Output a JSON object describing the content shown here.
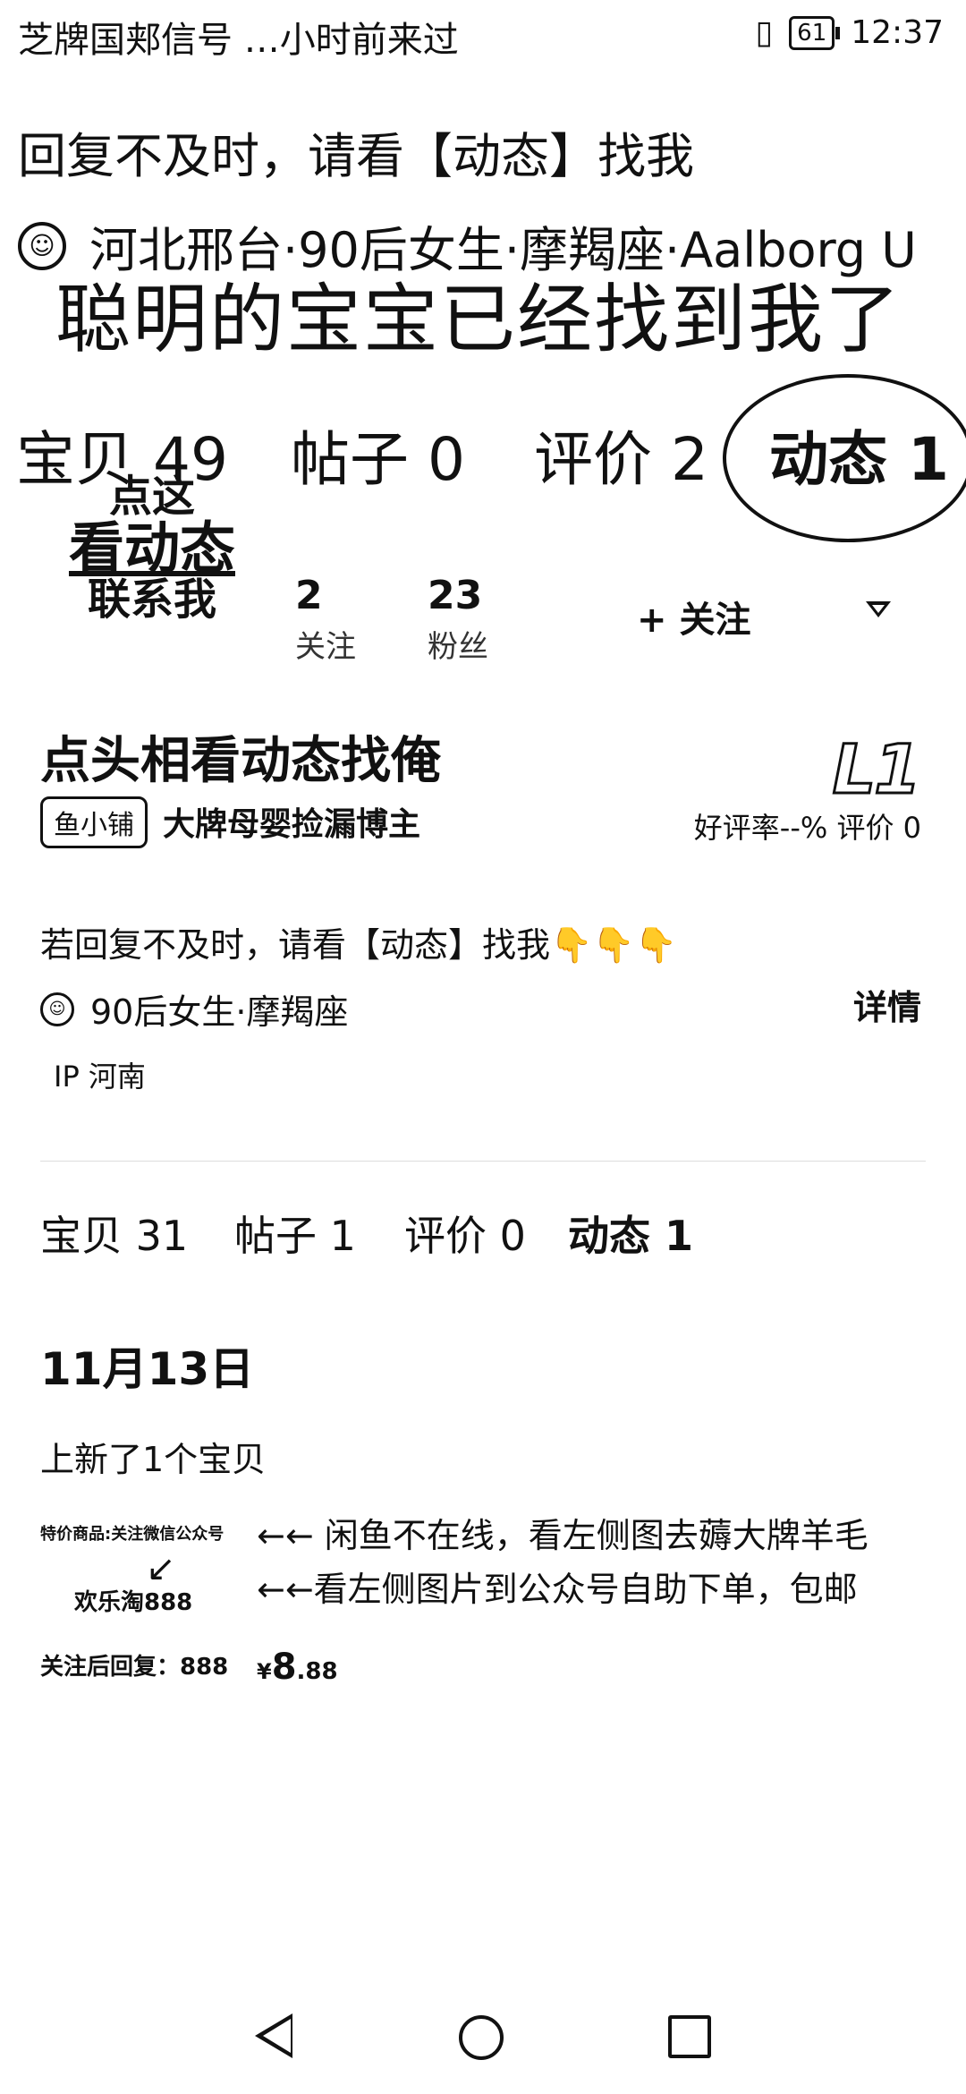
{
  "status_bar": {
    "left_text": "芝牌国郏信号 …小时前来过",
    "battery": "61",
    "time": "12:37"
  },
  "banner": {
    "line1": "回复不及时，请看【动态】找我",
    "line2": "河北邢台·90后女生·摩羯座·Aalborg U",
    "line3": "聪明的宝宝已经找到我了",
    "tabs": [
      "宝贝 49",
      "帖子 0",
      "评价 2",
      "动态 1"
    ]
  },
  "profile": {
    "shout": [
      "点这",
      "看动态",
      "联系我"
    ],
    "stats": [
      {
        "num": "2",
        "label": "关注"
      },
      {
        "num": "23",
        "label": "粉丝"
      }
    ],
    "follow_label": "+ 关注",
    "shop_name": "点头相看动态找俺",
    "level": "L1",
    "shop_badge": "鱼小铺",
    "shop_tag": "大牌母婴捡漏博主",
    "rating": "好评率--%  评价 0",
    "bio": "若回复不及时，请看【动态】找我👇👇👇",
    "identity": "90后女生·摩羯座",
    "detail_label": "详情",
    "ip": "IP 河南"
  },
  "profile_tabs": [
    "宝贝 31",
    "帖子 1",
    "评价 0",
    "动态 1"
  ],
  "feed": {
    "date": "11月13日",
    "new_item_text": "上新了1个宝贝",
    "thumb_caption": "特价商品:关注微信公众号",
    "thumb_name": "欢乐淘888",
    "thumb_reply": "关注后回复：888",
    "price_currency": "¥",
    "price_int": "8",
    "price_dec": ".88",
    "note1": "←← 闲鱼不在线，看左侧图去薅大牌羊毛",
    "note2": "←←看左侧图片到公众号自助下单，包邮"
  }
}
